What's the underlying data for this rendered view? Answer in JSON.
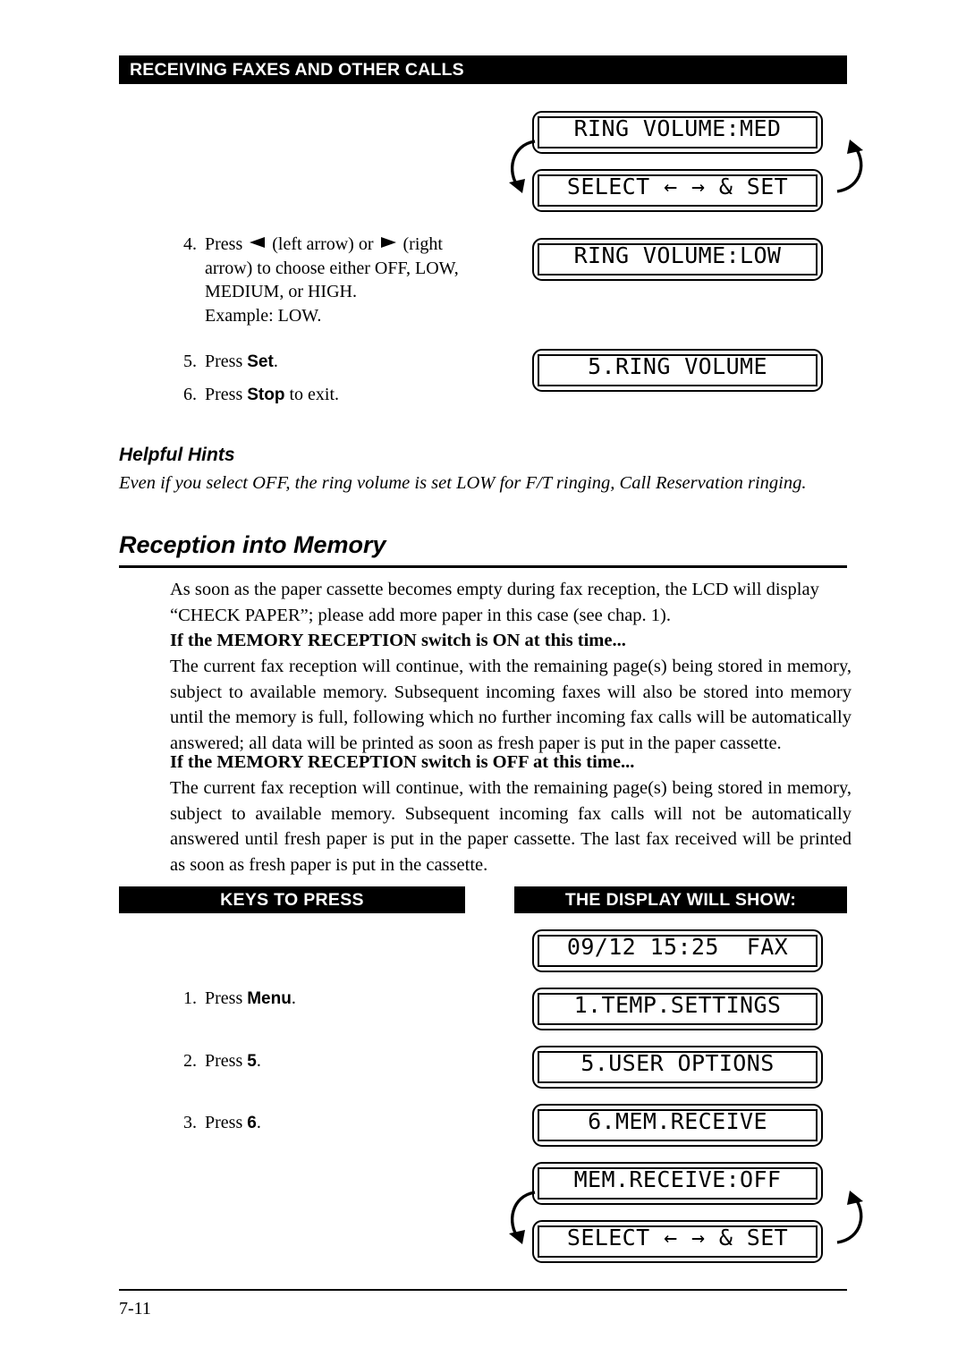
{
  "running_head": "RECEIVING FAXES AND OTHER CALLS",
  "top_section": {
    "lcd_screens": [
      {
        "id": "ring-volume-med",
        "text": "RING VOLUME:MED"
      },
      {
        "id": "select-and-set-1",
        "text": "SELECT ← → & SET"
      },
      {
        "id": "ring-volume-low",
        "text": "RING VOLUME:LOW"
      },
      {
        "id": "ring-volume-menu",
        "text": "5.RING VOLUME"
      }
    ],
    "steps": [
      {
        "number": "4.",
        "parts": [
          {
            "type": "text",
            "value": "Press "
          },
          {
            "type": "icon",
            "value": "left-arrow-triangle"
          },
          {
            "type": "text",
            "value": " (left arrow) or "
          },
          {
            "type": "icon",
            "value": "right-arrow-triangle"
          },
          {
            "type": "text",
            "value": " (right arrow) to choose either OFF, LOW, MEDIUM, or HIGH. Example: LOW."
          }
        ]
      },
      {
        "number": "5.",
        "parts": [
          {
            "type": "text",
            "value": "Press "
          },
          {
            "type": "key",
            "value": "Set"
          },
          {
            "type": "text",
            "value": "."
          }
        ]
      },
      {
        "number": "6.",
        "parts": [
          {
            "type": "text",
            "value": "Press "
          },
          {
            "type": "key",
            "value": "Stop"
          },
          {
            "type": "text",
            "value": " to exit."
          }
        ]
      }
    ]
  },
  "helpful_hints": {
    "title": "Helpful Hints",
    "body": "Even if you select OFF, the ring volume is set LOW for F/T ringing, Call Reservation ringing."
  },
  "section": {
    "title": "Reception into Memory",
    "intro": "As soon as the paper cassette becomes empty during fax reception, the LCD will display “CHECK PAPER”; please add more paper in this case (see chap. 1).",
    "on_subhead": "If the MEMORY RECEPTION switch is ON at this time...",
    "on_body": "The current fax reception will continue, with the remaining page(s) being stored in memory, subject to available memory. Subsequent incoming faxes will also be stored into memory until the memory is full, following which no further incoming fax calls will be automatically answered; all data will be printed as soon as fresh paper is put in the paper cassette.",
    "off_subhead": "If the MEMORY RECEPTION switch is OFF at this time...",
    "off_body": "The current fax reception will continue, with the remaining page(s) being stored in memory, subject to available memory. Subsequent incoming fax calls will not be automatically answered until fresh paper is put in the paper cassette. The last fax received will be printed as soon as fresh paper is put in the cassette."
  },
  "procedure_table": {
    "keys_header": "KEYS TO PRESS",
    "display_header": "THE DISPLAY WILL SHOW:",
    "steps": [
      {
        "number": "1.",
        "parts": [
          {
            "type": "text",
            "value": "Press "
          },
          {
            "type": "key",
            "value": "Menu"
          },
          {
            "type": "text",
            "value": "."
          }
        ]
      },
      {
        "number": "2.",
        "parts": [
          {
            "type": "text",
            "value": "Press "
          },
          {
            "type": "key",
            "value": "5"
          },
          {
            "type": "text",
            "value": "."
          }
        ]
      },
      {
        "number": "3.",
        "parts": [
          {
            "type": "text",
            "value": "Press "
          },
          {
            "type": "key",
            "value": "6"
          },
          {
            "type": "text",
            "value": "."
          }
        ]
      }
    ],
    "lcd_screens": [
      {
        "id": "idle-fax",
        "text": "09/12 15:25  FAX"
      },
      {
        "id": "temp-settings",
        "text": "1.TEMP.SETTINGS"
      },
      {
        "id": "user-options",
        "text": "5.USER OPTIONS"
      },
      {
        "id": "mem-receive-menu",
        "text": "6.MEM.RECEIVE"
      },
      {
        "id": "mem-receive-off",
        "text": "MEM.RECEIVE:OFF"
      },
      {
        "id": "select-and-set-2",
        "text": "SELECT ← → & SET"
      }
    ]
  },
  "footer": {
    "page_number": "7-11"
  },
  "colors": {
    "ink": "#000000",
    "paper": "#ffffff",
    "bar_bg": "#000000",
    "bar_text": "#ffffff"
  }
}
